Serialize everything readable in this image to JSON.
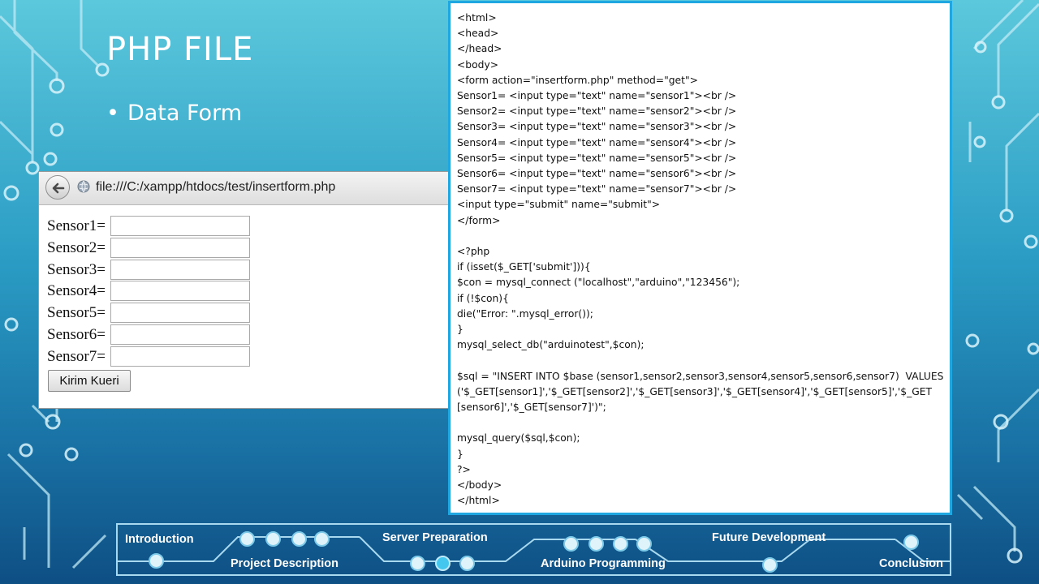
{
  "slide": {
    "title": "PHP FILE",
    "bullet": "Data Form"
  },
  "browser": {
    "url": "file:///C:/xampp/htdocs/test/insertform.php",
    "fields": [
      {
        "label": "Sensor1="
      },
      {
        "label": "Sensor2="
      },
      {
        "label": "Sensor3="
      },
      {
        "label": "Sensor4="
      },
      {
        "label": "Sensor5="
      },
      {
        "label": "Sensor6="
      },
      {
        "label": "Sensor7="
      }
    ],
    "submit_label": "Kirim Kueri"
  },
  "code": {
    "lines": [
      "<html>",
      "<head>",
      "</head>",
      "<body>",
      "<form action=\"insertform.php\" method=\"get\">",
      "Sensor1= <input type=\"text\" name=\"sensor1\"><br />",
      "Sensor2= <input type=\"text\" name=\"sensor2\"><br />",
      "Sensor3= <input type=\"text\" name=\"sensor3\"><br />",
      "Sensor4= <input type=\"text\" name=\"sensor4\"><br />",
      "Sensor5= <input type=\"text\" name=\"sensor5\"><br />",
      "Sensor6= <input type=\"text\" name=\"sensor6\"><br />",
      "Sensor7= <input type=\"text\" name=\"sensor7\"><br />",
      "<input type=\"submit\" name=\"submit\">",
      "</form>",
      "",
      "<?php",
      "if (isset($_GET['submit'])){",
      "$con = mysql_connect (\"localhost\",\"arduino\",\"123456\");",
      "if (!$con){",
      "die(\"Error: \".mysql_error());",
      "}",
      "mysql_select_db(\"arduinotest\",$con);",
      "",
      "$sql = \"INSERT INTO $base (sensor1,sensor2,sensor3,sensor4,sensor5,sensor6,sensor7)  VALUES",
      "('$_GET[sensor1]','$_GET[sensor2]','$_GET[sensor3]','$_GET[sensor4]','$_GET[sensor5]','$_GET",
      "[sensor6]','$_GET[sensor7]')\";",
      "",
      "mysql_query($sql,$con);",
      "}",
      "?>",
      "</body>",
      "</html>"
    ]
  },
  "nav": {
    "introduction": "Introduction",
    "project_description": "Project Description",
    "server_preparation": "Server Preparation",
    "arduino_programming": "Arduino Programming",
    "future_development": "Future Development",
    "conclusion": "Conclusion"
  },
  "colors": {
    "code_border": "#1ea7e0",
    "active_dot": "#43c7ee",
    "nav_border": "#a9d9ee"
  }
}
